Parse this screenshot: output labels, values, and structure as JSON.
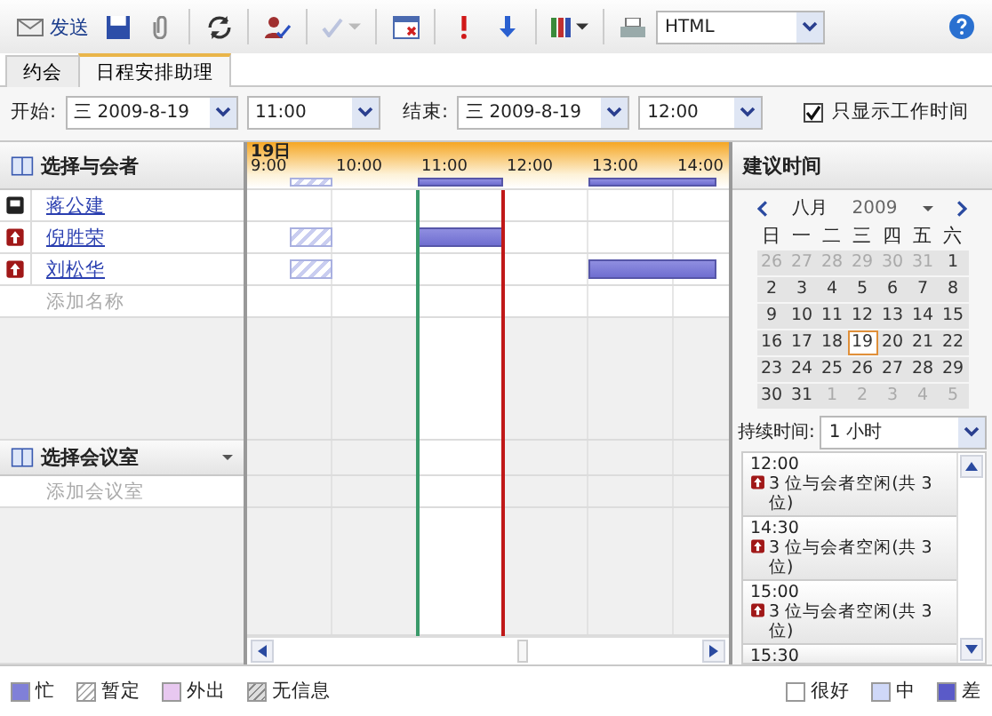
{
  "toolbar": {
    "send": "发送",
    "spell_check": {
      "disabled": true
    },
    "format": "HTML"
  },
  "tabs": [
    {
      "label": "约会",
      "selected": false
    },
    {
      "label": "日程安排助理",
      "selected": true
    }
  ],
  "time_row": {
    "start_label": "开始:",
    "start_date": "三  2009-8-19",
    "start_time": "11:00",
    "end_label": "结束:",
    "end_date": "三  2009-8-19",
    "end_time": "12:00",
    "working_hours_only": {
      "label": "只显示工作时间",
      "checked": true
    }
  },
  "attendees": {
    "title": "选择与会者",
    "placeholder": "添加名称",
    "items": [
      {
        "name": "蒋公建",
        "kind": "organizer",
        "slots": [
          {
            "kind": "free"
          },
          {
            "kind": "free"
          },
          {
            "kind": "free"
          },
          {
            "kind": "free"
          },
          {
            "kind": "free"
          },
          {
            "kind": "free"
          },
          {
            "kind": "free"
          },
          {
            "kind": "free"
          },
          {
            "kind": "free"
          },
          {
            "kind": "free"
          },
          {
            "kind": "free"
          },
          {
            "kind": "free"
          }
        ]
      },
      {
        "name": "倪胜荣",
        "kind": "required",
        "slots": [
          {
            "kind": "free"
          },
          {
            "kind": "tentative"
          },
          {
            "kind": "free"
          },
          {
            "kind": "free"
          },
          {
            "kind": "busy"
          },
          {
            "kind": "busy"
          },
          {
            "kind": "free"
          },
          {
            "kind": "free"
          },
          {
            "kind": "free"
          },
          {
            "kind": "free"
          },
          {
            "kind": "free"
          },
          {
            "kind": "free"
          }
        ]
      },
      {
        "name": "刘松华",
        "kind": "required",
        "slots": [
          {
            "kind": "free"
          },
          {
            "kind": "tentative"
          },
          {
            "kind": "free"
          },
          {
            "kind": "free"
          },
          {
            "kind": "free"
          },
          {
            "kind": "free"
          },
          {
            "kind": "free"
          },
          {
            "kind": "free"
          },
          {
            "kind": "busy"
          },
          {
            "kind": "busy"
          },
          {
            "kind": "busy"
          },
          {
            "kind": "free"
          }
        ]
      }
    ]
  },
  "rooms": {
    "title": "选择会议室",
    "placeholder": "添加会议室"
  },
  "timeline": {
    "day": "19日",
    "hours": [
      "9:00",
      "10:00",
      "11:00",
      "12:00",
      "13:00",
      "14:00"
    ],
    "slots": [
      {
        "kind": "free",
        "selected": false
      },
      {
        "kind": "tentative",
        "selected": false
      },
      {
        "kind": "free",
        "selected": false
      },
      {
        "kind": "free",
        "selected": false
      },
      {
        "kind": "busy",
        "selected": true
      },
      {
        "kind": "busy",
        "selected": true
      },
      {
        "kind": "free",
        "selected": false
      },
      {
        "kind": "free",
        "selected": false
      },
      {
        "kind": "busy",
        "selected": false
      },
      {
        "kind": "busy",
        "selected": false
      },
      {
        "kind": "busy",
        "selected": false
      },
      {
        "kind": "free",
        "selected": false
      }
    ]
  },
  "suggestions": {
    "title": "建议时间",
    "calendar": {
      "month": "八月",
      "year": "2009",
      "weekdays": [
        "日",
        "一",
        "二",
        "三",
        "四",
        "五",
        "六"
      ],
      "days": [
        {
          "label": "26",
          "muted": true,
          "selected": false
        },
        {
          "label": "27",
          "muted": true,
          "selected": false
        },
        {
          "label": "28",
          "muted": true,
          "selected": false
        },
        {
          "label": "29",
          "muted": true,
          "selected": false
        },
        {
          "label": "30",
          "muted": true,
          "selected": false
        },
        {
          "label": "31",
          "muted": true,
          "selected": false
        },
        {
          "label": "1",
          "muted": false,
          "selected": false
        },
        {
          "label": "2",
          "muted": false,
          "selected": false
        },
        {
          "label": "3",
          "muted": false,
          "selected": false
        },
        {
          "label": "4",
          "muted": false,
          "selected": false
        },
        {
          "label": "5",
          "muted": false,
          "selected": false
        },
        {
          "label": "6",
          "muted": false,
          "selected": false
        },
        {
          "label": "7",
          "muted": false,
          "selected": false
        },
        {
          "label": "8",
          "muted": false,
          "selected": false
        },
        {
          "label": "9",
          "muted": false,
          "selected": false
        },
        {
          "label": "10",
          "muted": false,
          "selected": false
        },
        {
          "label": "11",
          "muted": false,
          "selected": false
        },
        {
          "label": "12",
          "muted": false,
          "selected": false
        },
        {
          "label": "13",
          "muted": false,
          "selected": false
        },
        {
          "label": "14",
          "muted": false,
          "selected": false
        },
        {
          "label": "15",
          "muted": false,
          "selected": false
        },
        {
          "label": "16",
          "muted": false,
          "selected": false
        },
        {
          "label": "17",
          "muted": false,
          "selected": false
        },
        {
          "label": "18",
          "muted": false,
          "selected": false
        },
        {
          "label": "19",
          "muted": false,
          "selected": true
        },
        {
          "label": "20",
          "muted": false,
          "selected": false
        },
        {
          "label": "21",
          "muted": false,
          "selected": false
        },
        {
          "label": "22",
          "muted": false,
          "selected": false
        },
        {
          "label": "23",
          "muted": false,
          "selected": false
        },
        {
          "label": "24",
          "muted": false,
          "selected": false
        },
        {
          "label": "25",
          "muted": false,
          "selected": false
        },
        {
          "label": "26",
          "muted": false,
          "selected": false
        },
        {
          "label": "27",
          "muted": false,
          "selected": false
        },
        {
          "label": "28",
          "muted": false,
          "selected": false
        },
        {
          "label": "29",
          "muted": false,
          "selected": false
        },
        {
          "label": "30",
          "muted": false,
          "selected": false
        },
        {
          "label": "31",
          "muted": false,
          "selected": false
        },
        {
          "label": "1",
          "muted": true,
          "selected": false
        },
        {
          "label": "2",
          "muted": true,
          "selected": false
        },
        {
          "label": "3",
          "muted": true,
          "selected": false
        },
        {
          "label": "4",
          "muted": true,
          "selected": false
        },
        {
          "label": "5",
          "muted": true,
          "selected": false
        }
      ]
    },
    "duration_label": "持续时间:",
    "duration": "1 小时",
    "items": [
      {
        "time": "12:00",
        "text": "3 位与会者空闲(共 3 位)"
      },
      {
        "time": "14:30",
        "text": "3 位与会者空闲(共 3 位)"
      },
      {
        "time": "15:00",
        "text": "3 位与会者空闲(共 3 位)"
      },
      {
        "time": "15:30"
      }
    ]
  },
  "legend": {
    "statuses": [
      {
        "kind": "busy",
        "label": "忙"
      },
      {
        "kind": "tentative",
        "label": "暂定"
      },
      {
        "kind": "away",
        "label": "外出"
      },
      {
        "kind": "unknown",
        "label": "无信息"
      }
    ],
    "quality": [
      {
        "kind": "good",
        "label": "很好"
      },
      {
        "kind": "fair",
        "label": "中"
      },
      {
        "kind": "poor",
        "label": "差"
      }
    ]
  }
}
